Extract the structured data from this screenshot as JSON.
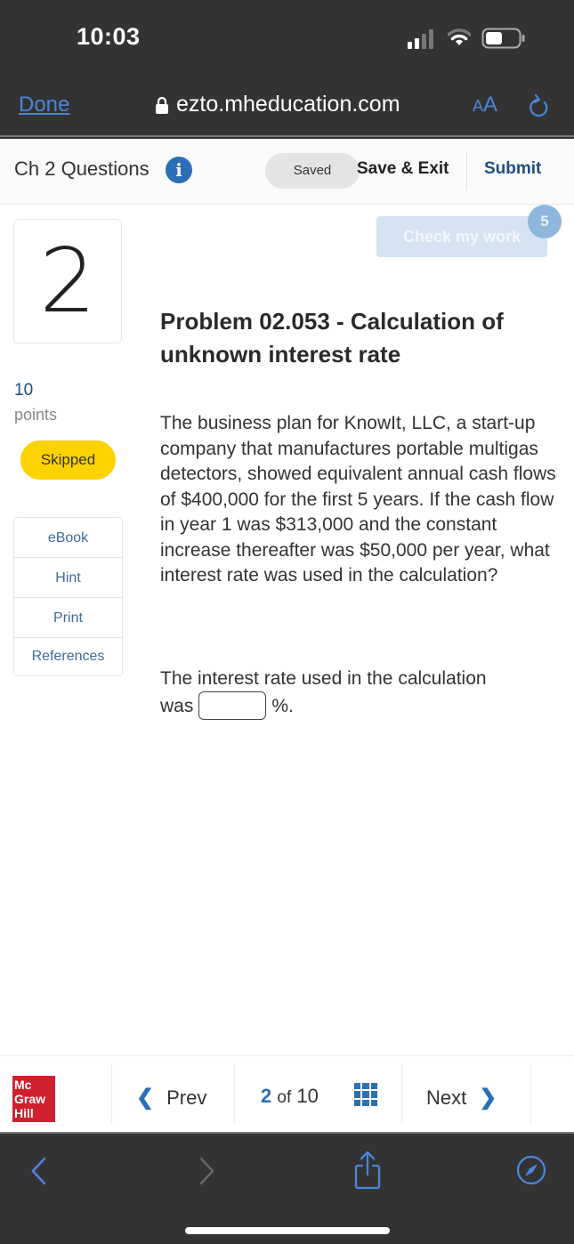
{
  "status_bar": {
    "time": "10:03"
  },
  "browser": {
    "done_label": "Done",
    "url": "ezto.mheducation.com",
    "text_size_label_small": "A",
    "text_size_label_large": "A"
  },
  "header": {
    "assignment_title": "Ch 2 Questions",
    "info_icon_glyph": "i",
    "saved_label": "Saved",
    "save_exit_label": "Save & Exit",
    "submit_label": "Submit"
  },
  "question": {
    "number": "2",
    "points_value": "10",
    "points_label": "points",
    "status": "Skipped",
    "check_work_label": "Check my work",
    "attempts_remaining": "5",
    "title": "Problem 02.053 - Calculation of unknown interest rate",
    "body": "The business plan for KnowIt, LLC, a start-up company that manufactures portable multigas detectors, showed equivalent annual cash flows of $400,000 for the first 5 years. If the cash flow in year 1 was $313,000 and the constant increase thereafter was $50,000 per year, what interest rate was used in the calculation?",
    "answer_prompt": "The interest rate used in the calculation",
    "answer_prefix": "was",
    "answer_value": "",
    "answer_suffix": "%."
  },
  "resources": [
    {
      "label": "eBook"
    },
    {
      "label": "Hint"
    },
    {
      "label": "Print"
    },
    {
      "label": "References"
    }
  ],
  "footer": {
    "logo_lines": [
      "Mc",
      "Graw",
      "Hill"
    ],
    "prev_label": "Prev",
    "current_page": "2",
    "of_label": "of",
    "total_pages": "10",
    "next_label": "Next"
  },
  "colors": {
    "accent_blue": "#2b6fb6",
    "submit_navy": "#1f4f82",
    "skipped_yellow": "#fcd300",
    "brand_red": "#d0202e",
    "safari_blue": "#4a86d8"
  }
}
